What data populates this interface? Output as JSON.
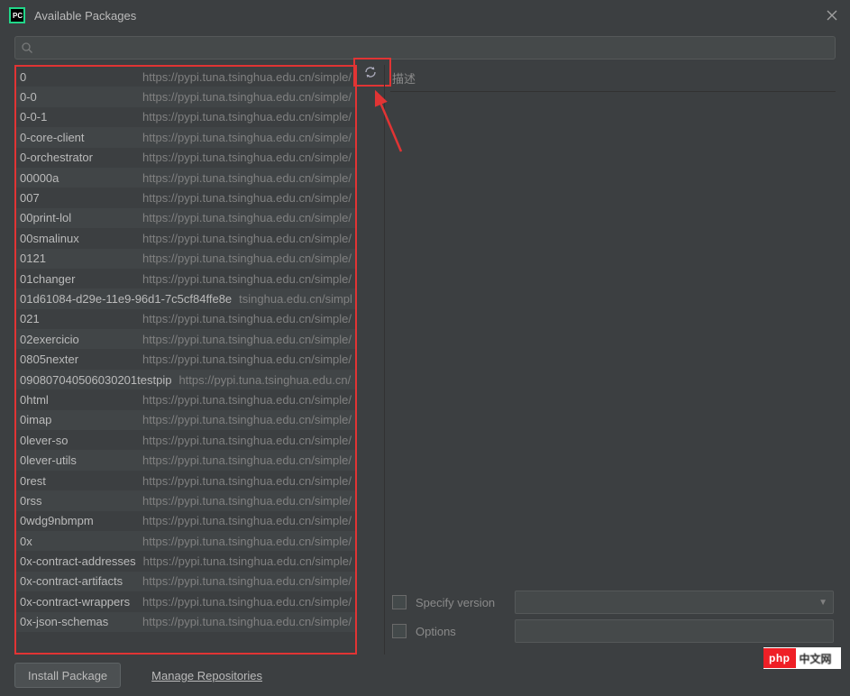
{
  "window": {
    "title": "Available Packages"
  },
  "search": {
    "value": ""
  },
  "refresh": {
    "icon": "refresh-icon"
  },
  "detail": {
    "desc_label": "描述",
    "specify_version_label": "Specify version",
    "options_label": "Options"
  },
  "buttons": {
    "install": "Install Package",
    "manage_repos": "Manage Repositories"
  },
  "watermark": {
    "left": "php",
    "right": "中文网"
  },
  "packages": [
    {
      "name": "0",
      "src": "https://pypi.tuna.tsinghua.edu.cn/simple/"
    },
    {
      "name": "0-0",
      "src": "https://pypi.tuna.tsinghua.edu.cn/simple/"
    },
    {
      "name": "0-0-1",
      "src": "https://pypi.tuna.tsinghua.edu.cn/simple/"
    },
    {
      "name": "0-core-client",
      "src": "https://pypi.tuna.tsinghua.edu.cn/simple/"
    },
    {
      "name": "0-orchestrator",
      "src": "https://pypi.tuna.tsinghua.edu.cn/simple/"
    },
    {
      "name": "00000a",
      "src": "https://pypi.tuna.tsinghua.edu.cn/simple/"
    },
    {
      "name": "007",
      "src": "https://pypi.tuna.tsinghua.edu.cn/simple/"
    },
    {
      "name": "00print-lol",
      "src": "https://pypi.tuna.tsinghua.edu.cn/simple/"
    },
    {
      "name": "00smalinux",
      "src": "https://pypi.tuna.tsinghua.edu.cn/simple/"
    },
    {
      "name": "0121",
      "src": "https://pypi.tuna.tsinghua.edu.cn/simple/"
    },
    {
      "name": "01changer",
      "src": "https://pypi.tuna.tsinghua.edu.cn/simple/"
    },
    {
      "name": "01d61084-d29e-11e9-96d1-7c5cf84ffe8e",
      "src": "tsinghua.edu.cn/simple/"
    },
    {
      "name": "021",
      "src": "https://pypi.tuna.tsinghua.edu.cn/simple/"
    },
    {
      "name": "02exercicio",
      "src": "https://pypi.tuna.tsinghua.edu.cn/simple/"
    },
    {
      "name": "0805nexter",
      "src": "https://pypi.tuna.tsinghua.edu.cn/simple/"
    },
    {
      "name": "090807040506030201testpip",
      "src": "https://pypi.tuna.tsinghua.edu.cn/simple/"
    },
    {
      "name": "0html",
      "src": "https://pypi.tuna.tsinghua.edu.cn/simple/"
    },
    {
      "name": "0imap",
      "src": "https://pypi.tuna.tsinghua.edu.cn/simple/"
    },
    {
      "name": "0lever-so",
      "src": "https://pypi.tuna.tsinghua.edu.cn/simple/"
    },
    {
      "name": "0lever-utils",
      "src": "https://pypi.tuna.tsinghua.edu.cn/simple/"
    },
    {
      "name": "0rest",
      "src": "https://pypi.tuna.tsinghua.edu.cn/simple/"
    },
    {
      "name": "0rss",
      "src": "https://pypi.tuna.tsinghua.edu.cn/simple/"
    },
    {
      "name": "0wdg9nbmpm",
      "src": "https://pypi.tuna.tsinghua.edu.cn/simple/"
    },
    {
      "name": "0x",
      "src": "https://pypi.tuna.tsinghua.edu.cn/simple/"
    },
    {
      "name": "0x-contract-addresses",
      "src": "https://pypi.tuna.tsinghua.edu.cn/simple/"
    },
    {
      "name": "0x-contract-artifacts",
      "src": "https://pypi.tuna.tsinghua.edu.cn/simple/"
    },
    {
      "name": "0x-contract-wrappers",
      "src": "https://pypi.tuna.tsinghua.edu.cn/simple/"
    },
    {
      "name": "0x-json-schemas",
      "src": "https://pypi.tuna.tsinghua.edu.cn/simple/"
    }
  ]
}
